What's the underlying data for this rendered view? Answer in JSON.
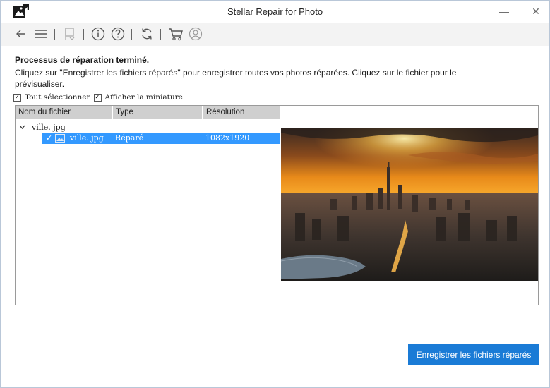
{
  "window": {
    "title": "Stellar Repair for Photo",
    "minimize_glyph": "—",
    "close_glyph": "✕"
  },
  "toolbar": {
    "icons": [
      "back-arrow-icon",
      "menu-icon",
      "bookmark-icon",
      "info-icon",
      "help-icon",
      "refresh-icon",
      "cart-icon",
      "user-icon"
    ]
  },
  "status": {
    "title": "Processus de réparation terminé.",
    "description": "Cliquez sur \"Enregistrer les fichiers réparés\" pour enregistrer toutes vos photos réparées. Cliquez sur le fichier pour le prévisualiser."
  },
  "options": {
    "select_all_label": "Tout sélectionner",
    "select_all_checked": true,
    "thumbnail_label": "Afficher la miniature",
    "thumbnail_checked": true,
    "check_glyph": "✓"
  },
  "table": {
    "columns": [
      "Nom du fichier",
      "Type",
      "Résolution"
    ],
    "folder": {
      "name": "ville. jpg",
      "expanded": true
    },
    "rows": [
      {
        "check": "✓",
        "name": "ville. jpg",
        "type": "Réparé",
        "resolution": "1082x1920",
        "selected": true
      }
    ]
  },
  "preview": {
    "subject": "city-skyline-sunset"
  },
  "actions": {
    "save_label": "Enregistrer les fichiers réparés"
  },
  "colors": {
    "accent": "#1a7bd6",
    "selection": "#3399ff",
    "header_bg": "#cfcfcf",
    "toolbar_bg": "#f3f3f3"
  }
}
